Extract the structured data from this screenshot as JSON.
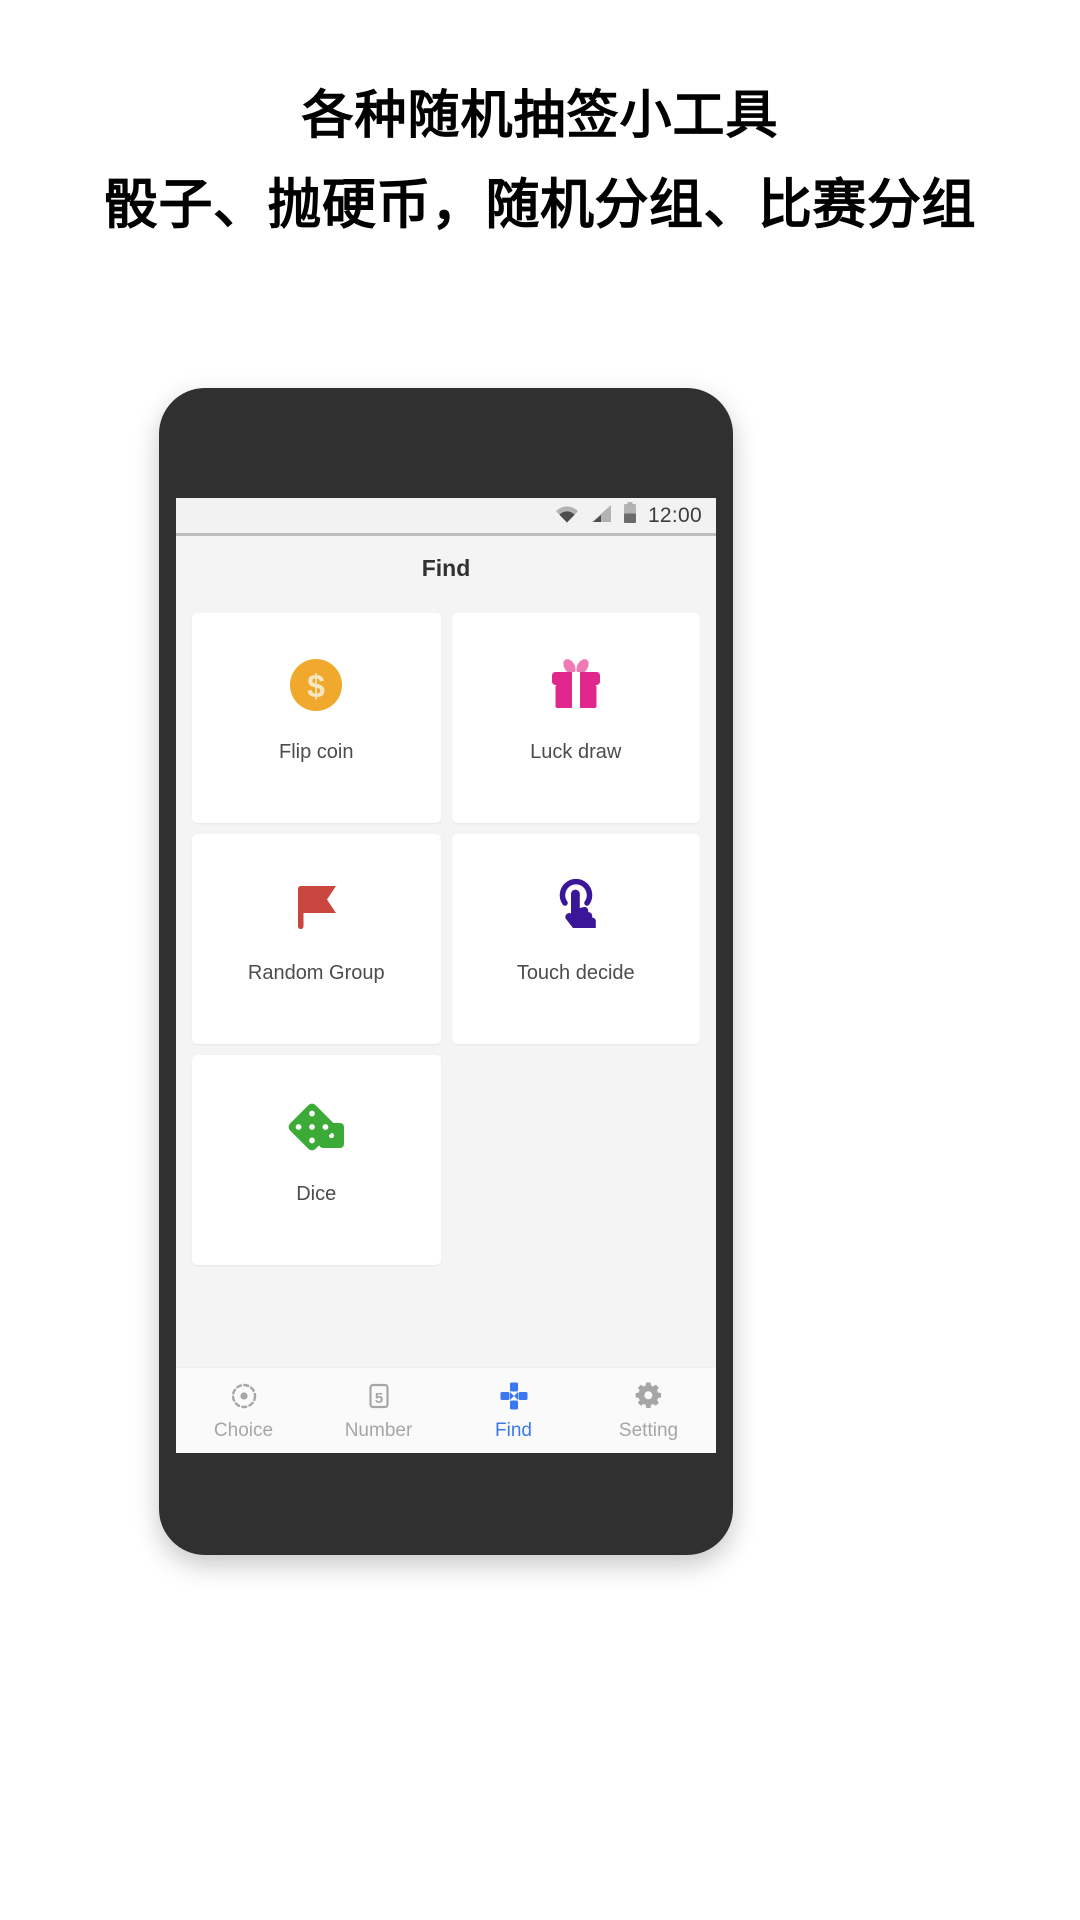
{
  "promo": {
    "title": "各种随机抽签小工具",
    "subtitle": "骰子、抛硬币，随机分组、比赛分组"
  },
  "phone": {
    "status_bar": {
      "time": "12:00",
      "icons": [
        "wifi-icon",
        "signal-icon",
        "battery-icon"
      ]
    },
    "app_bar": {
      "title": "Find"
    },
    "grid": {
      "items": [
        {
          "label": "Flip coin",
          "icon": "coin-dollar-icon",
          "color": "#f0a92c"
        },
        {
          "label": "Luck draw",
          "icon": "gift-box-icon",
          "color": "#e0278b"
        },
        {
          "label": "Random Group",
          "icon": "flag-icon",
          "color": "#c9463f"
        },
        {
          "label": "Touch decide",
          "icon": "touch-tap-icon",
          "color": "#3a1799"
        },
        {
          "label": "Dice",
          "icon": "dice-icon",
          "color": "#3caa36"
        }
      ]
    },
    "bottom_nav": {
      "active_color": "#3b78f0",
      "inactive_color": "#a6a6a6",
      "items": [
        {
          "label": "Choice",
          "icon": "target-dashed-icon",
          "active": false
        },
        {
          "label": "Number",
          "icon": "number-five-icon",
          "active": false
        },
        {
          "label": "Find",
          "icon": "dpad-icon",
          "active": true
        },
        {
          "label": "Setting",
          "icon": "gear-icon",
          "active": false
        }
      ]
    }
  }
}
